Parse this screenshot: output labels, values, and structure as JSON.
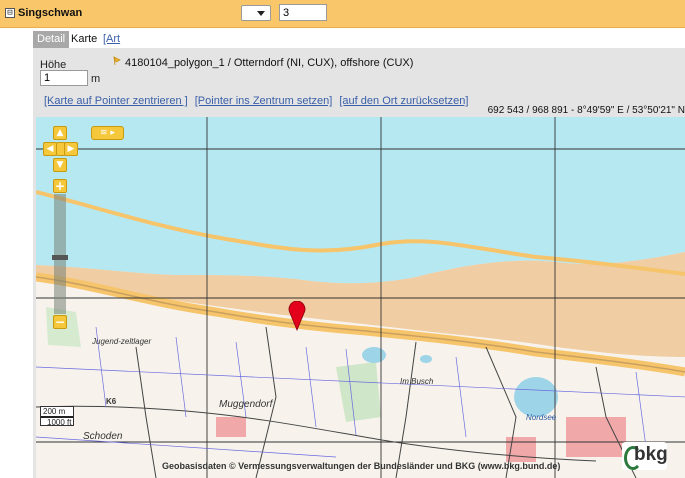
{
  "header": {
    "title": "Singschwan",
    "collapse_symbol": "⊟",
    "count_value": "3"
  },
  "tabs": [
    {
      "label": "Detail"
    },
    {
      "label": "Karte"
    },
    {
      "label": "[Art duplizieren]"
    }
  ],
  "form": {
    "hoehe_label": "Höhe",
    "hoehe_value": "1",
    "hoehe_unit": "m"
  },
  "location": {
    "icon": "pin-flag-icon",
    "text": "4180104_polygon_1 / Otterndorf (NI, CUX), offshore (CUX)"
  },
  "actions": [
    {
      "label": "[Karte auf Pointer zentrieren ]"
    },
    {
      "label": "[Pointer ins Zentrum setzen]"
    },
    {
      "label": "[auf den Ort zurücksetzen]"
    }
  ],
  "coords": "692 543 / 968 891 - 8°49'59\" E / 53°50'21\" N",
  "map": {
    "scale_top": "200 m",
    "scale_bottom": "1000 ft",
    "attribution": "Geobasisdaten © Vermessungsverwaltungen der Bundesländer und BKG (www.bkg.bund.de)",
    "logo_text": "bkg",
    "labels": {
      "jugend": "Jugend-zeltlager",
      "muggendorf": "Muggendorf",
      "schoden": "Schoden",
      "imbusch": "Im Busch",
      "nordsee": "Nordsee",
      "k6": "K6"
    },
    "colors": {
      "water": "#b6e8f2",
      "sand": "#f0cda2",
      "dike": "#f6c46a",
      "marker": "#e3001b"
    }
  }
}
